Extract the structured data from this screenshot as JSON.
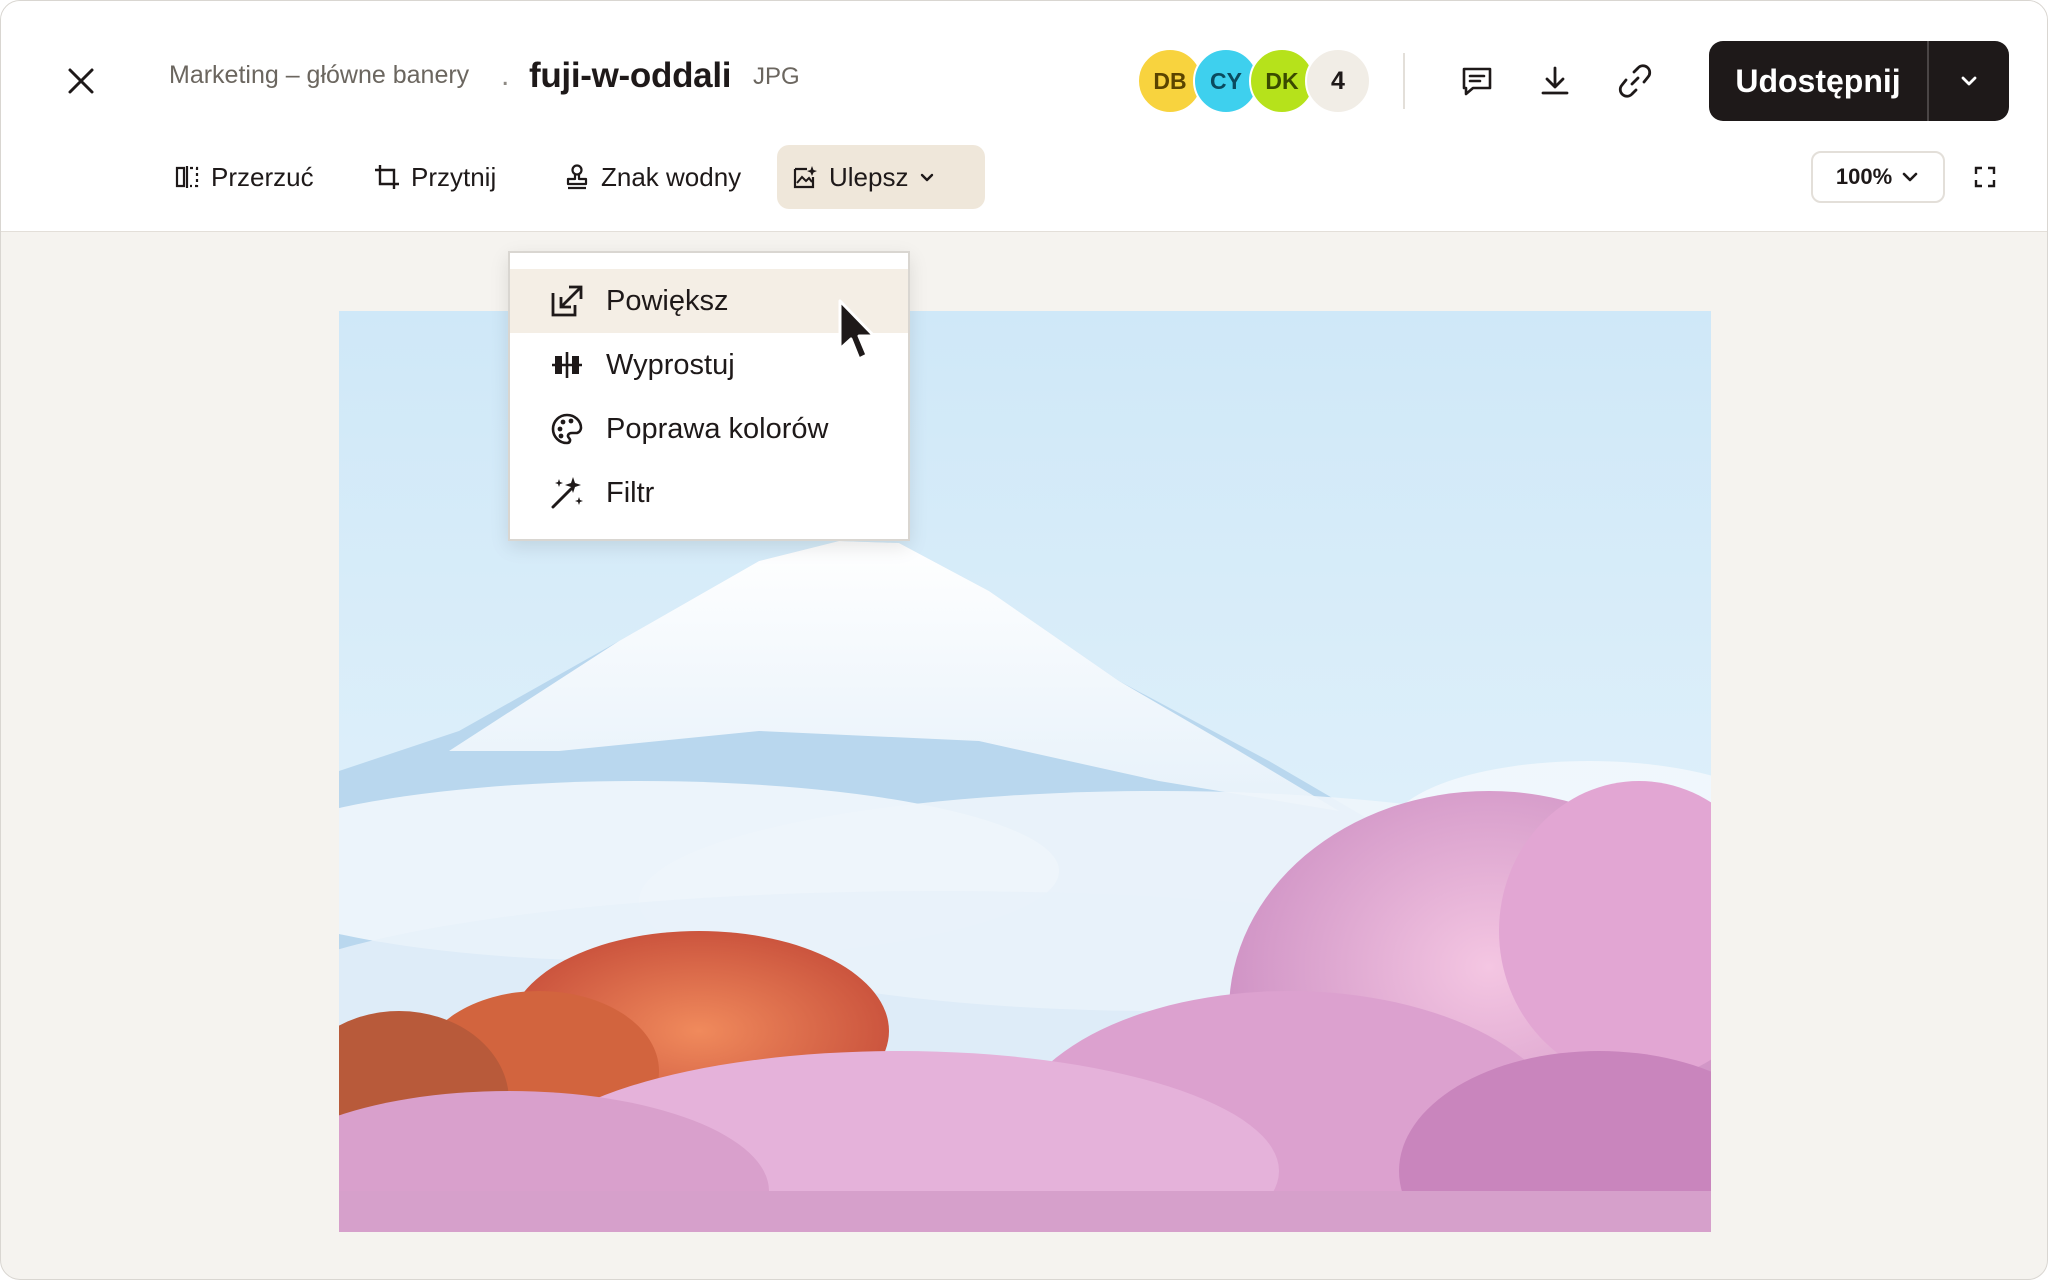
{
  "header": {
    "breadcrumb": "Marketing – główne banery",
    "separator": ".",
    "file_name": "fuji-w-oddali",
    "file_ext": "JPG",
    "close_icon": "close-icon",
    "avatars": [
      {
        "initials": "DB",
        "color": "#f8d33e"
      },
      {
        "initials": "CY",
        "color": "#3ed0ee"
      },
      {
        "initials": "DK",
        "color": "#b6e21b"
      }
    ],
    "avatars_more": "4",
    "icons": [
      "comment-icon",
      "download-icon",
      "link-icon"
    ],
    "share_label": "Udostępnij",
    "share_menu_icon": "chevron-down-icon",
    "share_color": "#1e1919"
  },
  "toolbar": {
    "items": [
      {
        "label": "Przerzuć",
        "icon": "flip-icon"
      },
      {
        "label": "Przytnij",
        "icon": "crop-icon"
      },
      {
        "label": "Znak wodny",
        "icon": "stamp-icon"
      },
      {
        "label": "Ulepsz",
        "icon": "enhance-icon",
        "active": true
      }
    ],
    "zoom": "100%",
    "fullscreen_icon": "fullscreen-icon"
  },
  "enhance_menu": {
    "items": [
      {
        "label": "Powiększ",
        "icon": "upscale-icon",
        "hovered": true
      },
      {
        "label": "Wyprostuj",
        "icon": "straighten-icon"
      },
      {
        "label": "Poprawa kolorów",
        "icon": "palette-icon"
      },
      {
        "label": "Filtr",
        "icon": "magic-wand-icon"
      }
    ]
  },
  "accent_color": "#efe7da"
}
